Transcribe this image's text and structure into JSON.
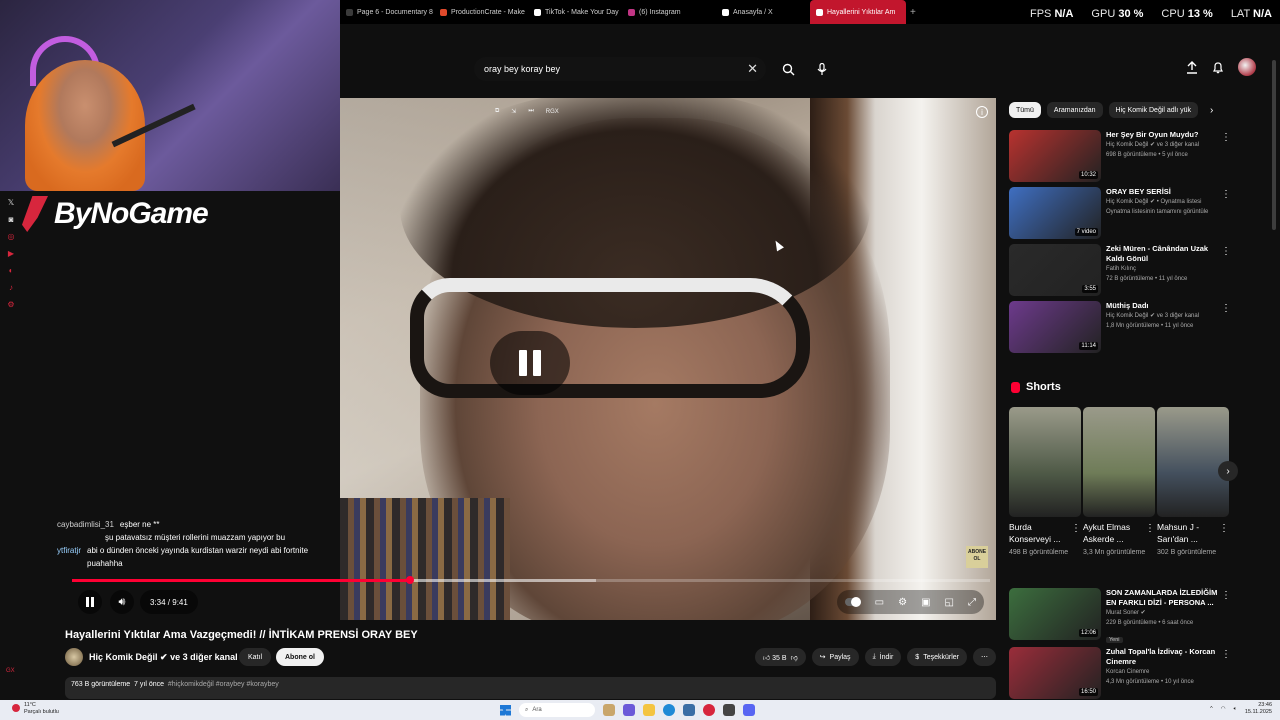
{
  "tabs": [
    {
      "label": "Page 6 - Documentary 8",
      "color": "#3a3a3a"
    },
    {
      "label": "ProductionCrate - Make",
      "color": "#e0492b"
    },
    {
      "label": "TikTok - Make Your Day",
      "color": "#ffffff"
    },
    {
      "label": "(6) Instagram",
      "color": "#c13584"
    },
    {
      "label": "Anasayfa / X",
      "color": "#ffffff"
    },
    {
      "label": "Hayallerini Yıktılar Am",
      "color": "#ffffff"
    }
  ],
  "stats": {
    "fps_label": "FPS",
    "fps_value": "N/A",
    "gpu_label": "GPU",
    "gpu_value": "30",
    "cpu_label": "CPU",
    "cpu_value": "13",
    "lat_label": "LAT",
    "lat_value": "N/A",
    "percent_sign": "%"
  },
  "stream": {
    "brand": "ByNoGame"
  },
  "search": {
    "query": "oray bey koray bey"
  },
  "player": {
    "rgx_label": "RGX",
    "time": "3:34 / 9:41",
    "progress": 0.368,
    "buffered": 0.571,
    "abone_label": "ABONE OL"
  },
  "chat": [
    {
      "name": "caybadimlisi_31",
      "name_color": "#cfcfcf",
      "msg": "eşber ne **"
    },
    {
      "name": "",
      "name_color": "#cfcfcf",
      "msg": "şu patavatsız müşteri rollerini muazzam yapıyor bu"
    },
    {
      "name": "ytfiratjr",
      "name_color": "#9ad1ff",
      "msg": "abi o dünden önceki yayında kurdistan warzir neydi abi fortnite puahahha"
    }
  ],
  "video": {
    "title": "Hayallerini Yıktılar Ama Vazgeçmedi! // İNTİKAM PRENSİ ORAY BEY",
    "channel": "Hiç Komik Değil",
    "channel_suffix": "ve 3 diğer kanal",
    "join_label": "Katıl",
    "subscribe_label": "Abone ol",
    "likes": "35 B",
    "share_label": "Paylaş",
    "download_label": "İndir",
    "thanks_label": "Teşekkürler",
    "views": "763 B görüntüleme",
    "age": "7 yıl önce",
    "hashtags": "#hiçkomikdeğil #oraybey #koraybey"
  },
  "chips": [
    {
      "label": "Tümü"
    },
    {
      "label": "Aramanızdan"
    },
    {
      "label": "Hiç Komik Değil adlı yük"
    }
  ],
  "recommendations_top": [
    {
      "title": "Her Şey Bir Oyun Muydu?",
      "channel": "Hiç Komik Değil ✔ ve 3 diğer kanal",
      "meta": "698 B görüntüleme • 5 yıl önce",
      "duration": "10:32",
      "thumb_color": "#b8322f"
    },
    {
      "title": "ORAY BEY SERİSİ",
      "channel": "Hiç Komik Değil ✔ • Oynatma listesi",
      "meta": "Oynatma listesinin tamamını görüntüle",
      "duration": "7 video",
      "thumb_color": "#3f6fc2"
    },
    {
      "title": "Zeki Müren - Cânândan Uzak Kaldı Gönül",
      "channel": "Fatih Kılınç",
      "meta": "72 B görüntüleme • 11 yıl önce",
      "duration": "3:55",
      "thumb_color": "#2a2a2a"
    },
    {
      "title": "Müthiş Dadı",
      "channel": "Hiç Komik Değil ✔ ve 3 diğer kanal",
      "meta": "1,8 Mn görüntüleme • 11 yıl önce",
      "duration": "11:14",
      "thumb_color": "#6d3a8c"
    }
  ],
  "shorts": {
    "title": "Shorts",
    "items": [
      {
        "title": "Burda Konserveyi ...",
        "views": "498 B görüntüleme",
        "color": "#4f5a47"
      },
      {
        "title": "Aykut Elmas Askerde ...",
        "views": "3,3 Mn görüntüleme",
        "color": "#6f7c58"
      },
      {
        "title": "Mahsun J - Sarı'dan ...",
        "views": "302 B görüntüleme",
        "color": "#44505e"
      }
    ]
  },
  "recommendations_bottom": [
    {
      "title": "SON ZAMANLARDA İZLEDİĞİM EN FARKLI DİZİ - PERSONA ...",
      "channel": "Murat Soner ✔",
      "meta": "229 B görüntüleme • 6 saat önce",
      "badge": "Yeni",
      "duration": "12:06",
      "thumb_color": "#3c6e3e"
    },
    {
      "title": "Zuhal Topal'la İzdivaç - Korcan Cinemre",
      "channel": "Korcan Cinemre",
      "meta": "4,3 Mn görüntüleme • 10 yıl önce",
      "badge": "",
      "duration": "16:50",
      "thumb_color": "#9a2d3a"
    }
  ],
  "taskbar": {
    "weather_temp": "11°C",
    "weather_text": "Parçalı bulutlu",
    "search_placeholder": "Ara",
    "time": "23:46",
    "date": "15.11.2025"
  }
}
